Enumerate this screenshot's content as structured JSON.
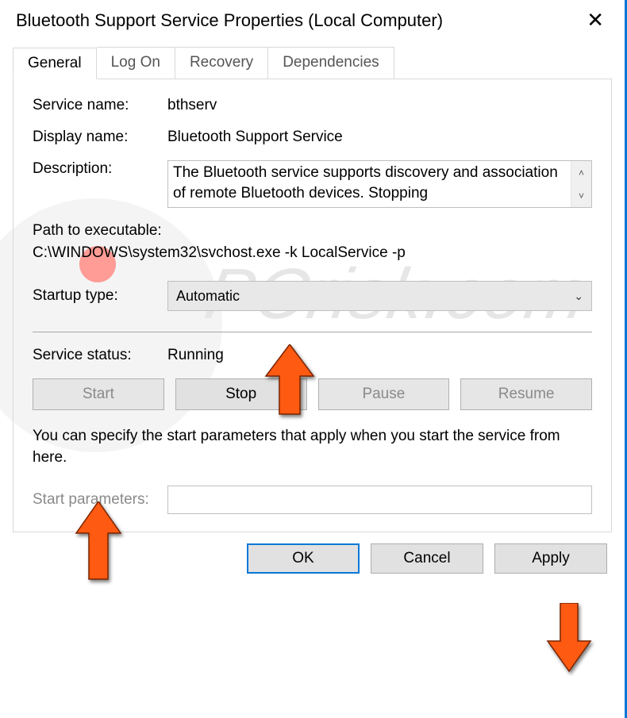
{
  "title": "Bluetooth Support Service Properties (Local Computer)",
  "tabs": {
    "general": "General",
    "logon": "Log On",
    "recovery": "Recovery",
    "dependencies": "Dependencies"
  },
  "labels": {
    "service_name": "Service name:",
    "display_name": "Display name:",
    "description": "Description:",
    "path_label": "Path to executable:",
    "startup_type": "Startup type:",
    "service_status": "Service status:",
    "start_parameters": "Start parameters:"
  },
  "values": {
    "service_name": "bthserv",
    "display_name": "Bluetooth Support Service",
    "description": "The Bluetooth service supports discovery and association of remote Bluetooth devices.  Stopping",
    "path": "C:\\WINDOWS\\system32\\svchost.exe -k LocalService -p",
    "startup_type": "Automatic",
    "service_status": "Running",
    "start_parameters": ""
  },
  "hint": "You can specify the start parameters that apply when you start the service from here.",
  "service_buttons": {
    "start": "Start",
    "stop": "Stop",
    "pause": "Pause",
    "resume": "Resume"
  },
  "dialog_buttons": {
    "ok": "OK",
    "cancel": "Cancel",
    "apply": "Apply"
  },
  "watermark": "PCrisk.com",
  "arrow_color": "#ff5a12"
}
